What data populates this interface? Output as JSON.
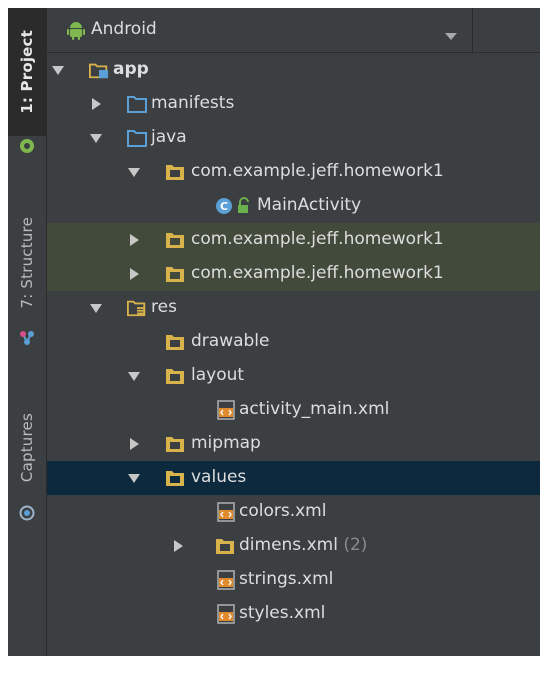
{
  "left_strip": {
    "tabs": [
      {
        "label": "1: Project",
        "icon": "android-icon",
        "active": true
      },
      {
        "label": "7: Structure",
        "icon": "structure-icon",
        "active": false
      },
      {
        "label": "Captures",
        "icon": "captures-icon",
        "active": false
      }
    ]
  },
  "header": {
    "view_icon": "android-icon",
    "view_label": "Android"
  },
  "tree": {
    "app": "app",
    "manifests": "manifests",
    "java": "java",
    "pkg_main": "com.example.jeff.homework1",
    "main_activity": "MainActivity",
    "pkg_test1": "com.example.jeff.homework1",
    "pkg_test2": "com.example.jeff.homework1",
    "res": "res",
    "drawable": "drawable",
    "layout": "layout",
    "activity_main": "activity_main.xml",
    "mipmap": "mipmap",
    "values": "values",
    "colors": "colors.xml",
    "dimens": "dimens.xml",
    "dimens_count": "(2)",
    "strings": "strings.xml",
    "styles": "styles.xml"
  },
  "colors": {
    "panel_bg": "#3c3f41",
    "selection_bg": "#0d293e",
    "test_highlight_bg": "#424a3c",
    "folder_blue": "#5aa0d6",
    "package_yellow": "#d8b24a"
  }
}
